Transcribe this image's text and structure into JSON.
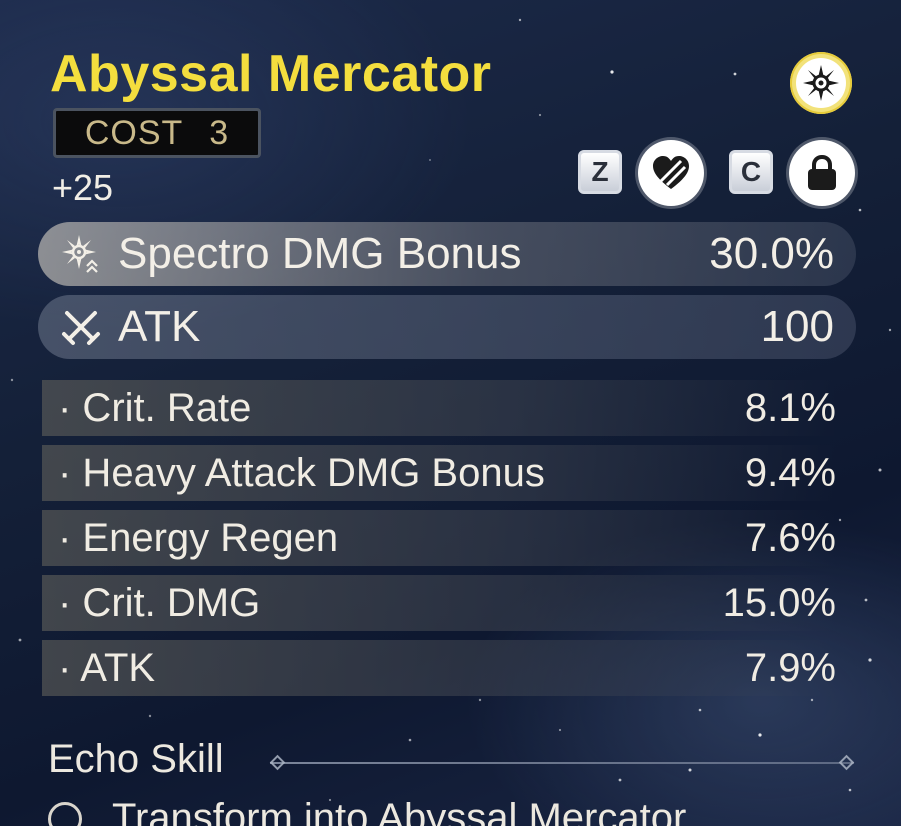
{
  "echo": {
    "name": "Abyssal Mercator",
    "cost_label": "COST",
    "cost_value": "3",
    "level": "+25",
    "element_icon": "spectro-element-icon"
  },
  "controls": {
    "favorite_key": "Z",
    "lock_key": "C",
    "favorite_icon": "heart-broken-icon",
    "lock_icon": "lock-icon"
  },
  "main_stats": [
    {
      "icon": "spectro-dmg-icon",
      "name": "Spectro DMG Bonus",
      "value": "30.0%"
    },
    {
      "icon": "atk-swords-icon",
      "name": "ATK",
      "value": "100"
    }
  ],
  "sub_stats": [
    {
      "name": "· Crit. Rate",
      "value": "8.1%"
    },
    {
      "name": "· Heavy Attack DMG Bonus",
      "value": "9.4%"
    },
    {
      "name": "· Energy Regen",
      "value": "7.6%"
    },
    {
      "name": "· Crit. DMG",
      "value": "15.0%"
    },
    {
      "name": "· ATK",
      "value": "7.9%"
    }
  ],
  "echo_skill": {
    "title": "Echo Skill",
    "first_line": "Transform into Abyssal Mercator"
  },
  "colors": {
    "title": "#f4de3e",
    "text": "#f3efe7",
    "element_ring": "#f2e27a"
  }
}
